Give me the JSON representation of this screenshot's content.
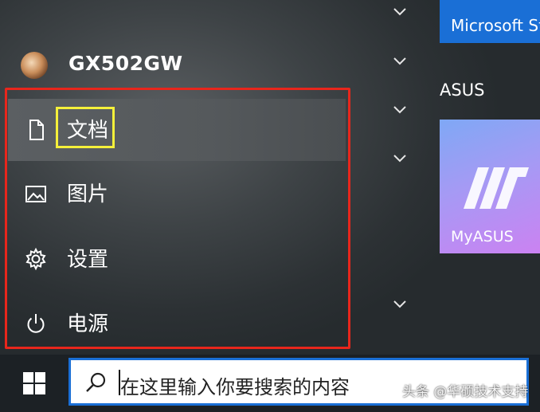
{
  "user": {
    "name": "GX502GW"
  },
  "nav": [
    {
      "label": "文档",
      "icon": "document-icon"
    },
    {
      "label": "图片",
      "icon": "pictures-icon"
    },
    {
      "label": "设置",
      "icon": "gear-icon"
    },
    {
      "label": "电源",
      "icon": "power-icon"
    }
  ],
  "tiles": {
    "store_label": "Microsoft Store",
    "group_title": "ASUS",
    "myasus_label": "MyASUS"
  },
  "search": {
    "placeholder": "在这里输入你要搜索的内容"
  },
  "watermark": "头条 @华硕技术支持",
  "colors": {
    "highlight": "#f5f03a",
    "annotation": "#e8261c",
    "accent": "#1a6fd6"
  }
}
